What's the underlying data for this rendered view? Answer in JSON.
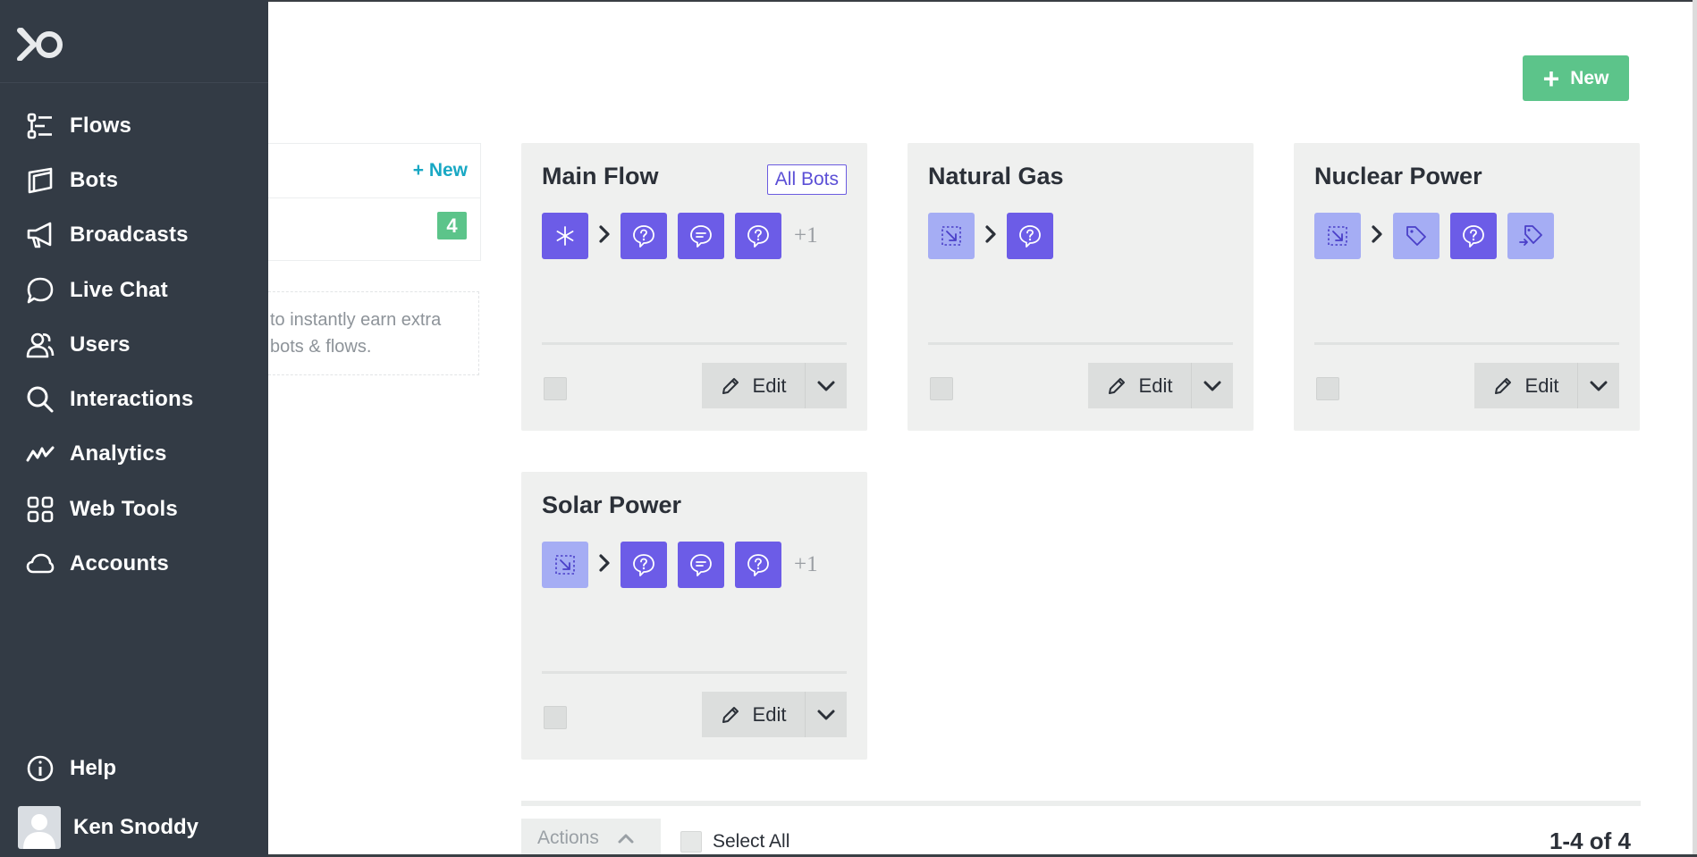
{
  "sidebar": {
    "items": [
      {
        "label": "Flows",
        "icon": "flows-icon"
      },
      {
        "label": "Bots",
        "icon": "bots-icon"
      },
      {
        "label": "Broadcasts",
        "icon": "megaphone-icon"
      },
      {
        "label": "Live Chat",
        "icon": "chat-bubble-icon"
      },
      {
        "label": "Users",
        "icon": "users-icon"
      },
      {
        "label": "Interactions",
        "icon": "search-icon"
      },
      {
        "label": "Analytics",
        "icon": "analytics-icon"
      },
      {
        "label": "Web Tools",
        "icon": "grid-icon"
      },
      {
        "label": "Accounts",
        "icon": "cloud-icon"
      }
    ],
    "help_label": "Help",
    "user_name": "Ken Snoddy"
  },
  "left_panel": {
    "new_label": "+ New",
    "count": "4",
    "promo_line1": "to instantly earn extra",
    "promo_line2": "bots & flows."
  },
  "toolbar": {
    "new_label": "New"
  },
  "cards": [
    {
      "title": "Main Flow",
      "badge": "All Bots",
      "more": "+1",
      "edit_label": "Edit"
    },
    {
      "title": "Natural Gas",
      "edit_label": "Edit"
    },
    {
      "title": "Nuclear Power",
      "edit_label": "Edit"
    },
    {
      "title": "Solar Power",
      "more": "+1",
      "edit_label": "Edit"
    }
  ],
  "footer": {
    "actions_label": "Actions",
    "select_all_label": "Select All",
    "pagination": "1-4 of 4"
  },
  "colors": {
    "sidebar_bg": "#333b45",
    "accent_green": "#5cc48a",
    "accent_teal": "#19a8c4",
    "step_dark": "#6c5ce7",
    "step_light": "#a5adf4",
    "card_bg": "#eff0ef"
  }
}
